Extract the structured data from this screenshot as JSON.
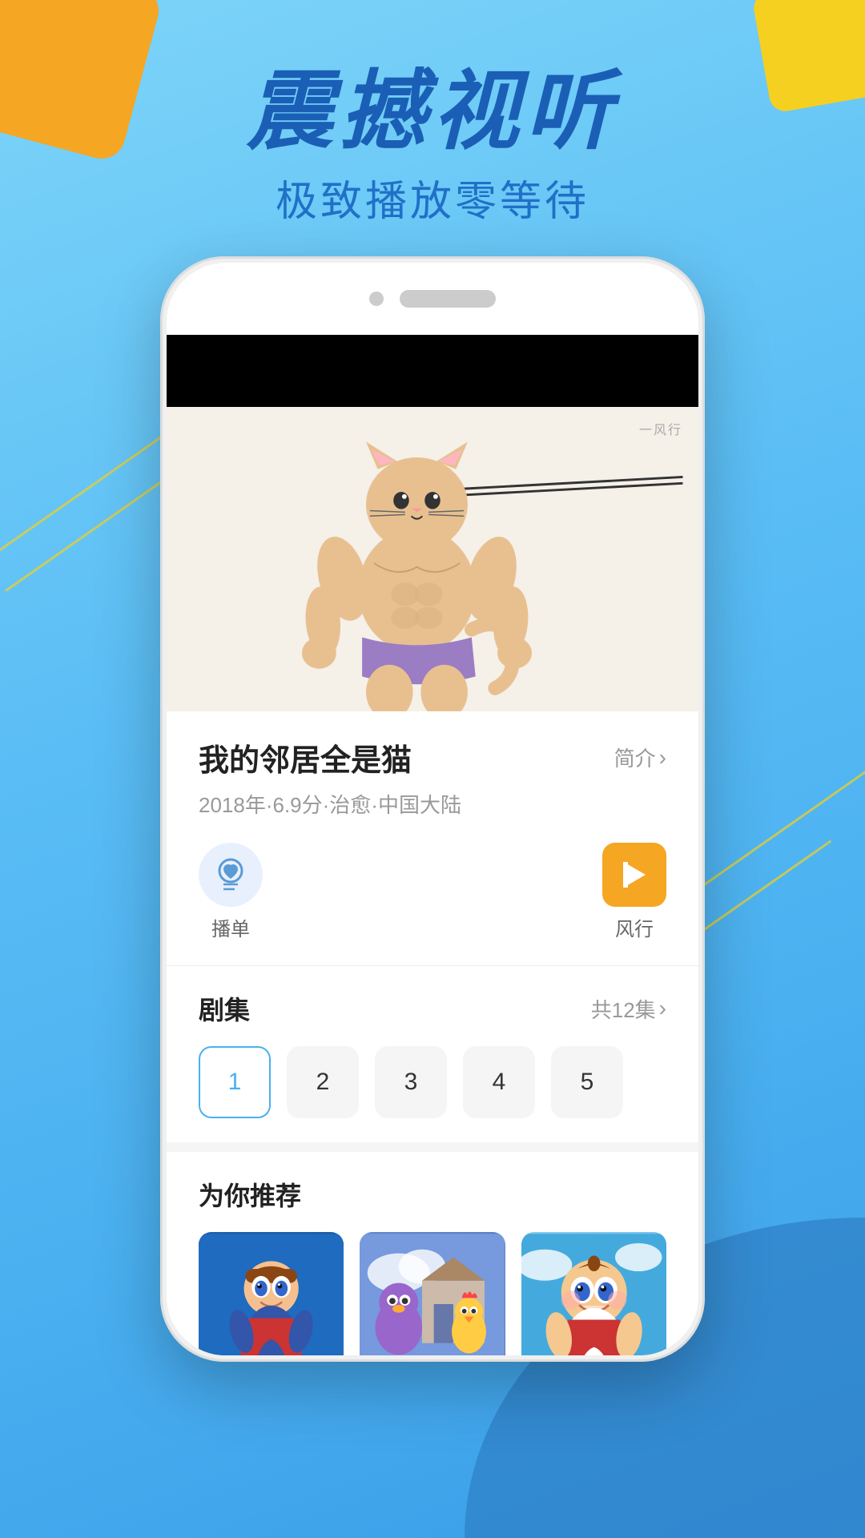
{
  "app": {
    "bg_color": "#5bbef5",
    "accent_color": "#f5a623",
    "hero_title": "震撼视听",
    "hero_subtitle": "极致播放零等待"
  },
  "phone": {
    "watermark": "一风行",
    "video_bg": "#f5f0e8"
  },
  "show": {
    "title": "我的邻居全是猫",
    "intro_label": "简介",
    "meta": "2018年·6.9分·治愈·中国大陆",
    "playlist_label": "播单",
    "fengxing_label": "风行",
    "episodes_section_title": "剧集",
    "episodes_total": "共12集",
    "episodes": [
      {
        "num": "1",
        "active": true
      },
      {
        "num": "2",
        "active": false
      },
      {
        "num": "3",
        "active": false
      },
      {
        "num": "4",
        "active": false
      },
      {
        "num": "5",
        "active": false
      }
    ],
    "recommend_title": "为你推荐",
    "recommend_items": [
      {
        "id": 1,
        "color_start": "#2d7fc4",
        "color_end": "#1a5fb5"
      },
      {
        "id": 2,
        "color_start": "#5b9bd5",
        "color_end": "#3a7abf"
      },
      {
        "id": 3,
        "color_start": "#7ec8f0",
        "color_end": "#5ab0e8"
      }
    ]
  },
  "icons": {
    "chevron_right": "›",
    "heart_icon": "♥",
    "playlist_symbol": "♫"
  }
}
